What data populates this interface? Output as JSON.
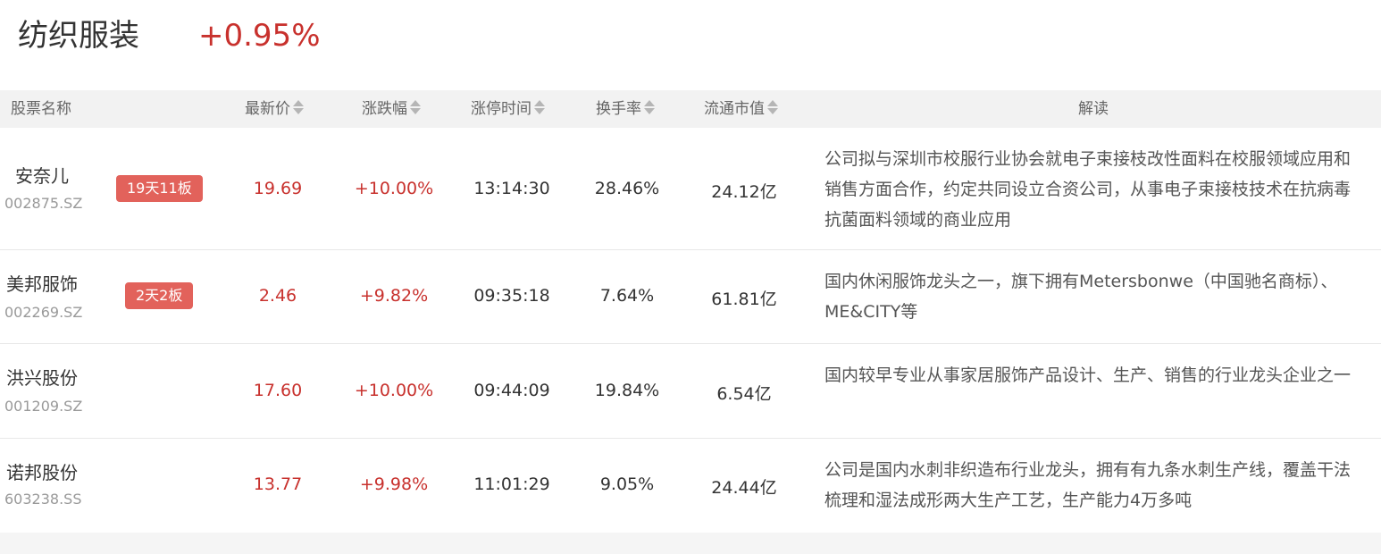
{
  "sector": {
    "name": "纺织服装",
    "change": "+0.95%"
  },
  "columns": {
    "name": "股票名称",
    "price": "最新价",
    "change": "涨跌幅",
    "limit_time": "涨停时间",
    "turnover": "换手率",
    "market_cap": "流通市值",
    "analysis": "解读"
  },
  "rows": [
    {
      "name": "安奈儿",
      "code": "002875.SZ",
      "badge": "19天11板",
      "price": "19.69",
      "change": "+10.00%",
      "limit_time": "13:14:30",
      "turnover": "28.46%",
      "market_cap": "24.12亿",
      "analysis": "公司拟与深圳市校服行业协会就电子束接枝改性面料在校服领域应用和销售方面合作，约定共同设立合资公司，从事电子束接枝技术在抗病毒抗菌面料领域的商业应用"
    },
    {
      "name": "美邦服饰",
      "code": "002269.SZ",
      "badge": "2天2板",
      "price": "2.46",
      "change": "+9.82%",
      "limit_time": "09:35:18",
      "turnover": "7.64%",
      "market_cap": "61.81亿",
      "analysis": "国内休闲服饰龙头之一，旗下拥有Metersbonwe（中国驰名商标）、ME&CITY等"
    },
    {
      "name": "洪兴股份",
      "code": "001209.SZ",
      "badge": "",
      "price": "17.60",
      "change": "+10.00%",
      "limit_time": "09:44:09",
      "turnover": "19.84%",
      "market_cap": "6.54亿",
      "analysis": "国内较早专业从事家居服饰产品设计、生产、销售的行业龙头企业之一"
    },
    {
      "name": "诺邦股份",
      "code": "603238.SS",
      "badge": "",
      "price": "13.77",
      "change": "+9.98%",
      "limit_time": "11:01:29",
      "turnover": "9.05%",
      "market_cap": "24.44亿",
      "analysis": "公司是国内水刺非织造布行业龙头，拥有有九条水刺生产线，覆盖干法梳理和湿法成形两大生产工艺，生产能力4万多吨"
    }
  ],
  "colors": {
    "up": "#c8312d",
    "badge": "#e2625b",
    "header_bg": "#f2f2f2"
  },
  "icons": {
    "sort": "sort-updown-icon"
  }
}
